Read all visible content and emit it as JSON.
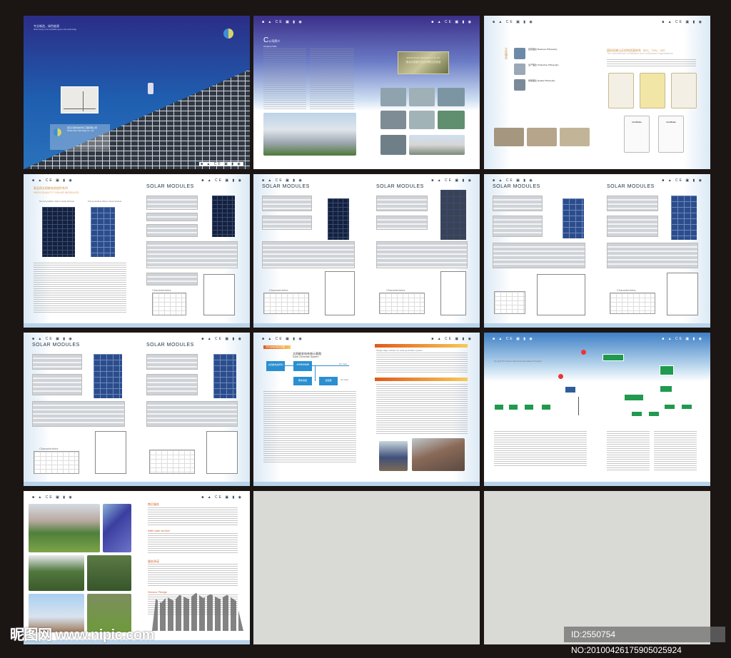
{
  "cover": {
    "tagline_cn": "专业制造，绿色能源",
    "tagline_en": "Solar energy is the worldwide green in the world today",
    "company_cn": "武汉日新科技光伏工程有限公司",
    "company_en": "Wuhan Rixin Technology Co., Ltd."
  },
  "certs_icons": "■ ▲ CE ▣ ▮ ◉",
  "intro": {
    "title_cn": "公司简介",
    "title_en": "Company Profile",
    "plaque_en": "WUHAN SOLAR TECHNOLOGY CO.,LTD.",
    "plaque_cn": "湖北太阳能光伏技术联合实验室"
  },
  "culture": {
    "side_title": "文化理念",
    "items": [
      "经营理念 Business Philosophy",
      "生产理念 Production Philosophy",
      "质量理念 Quality Philosophy"
    ],
    "cert_title_cn": "国际权威认证机构质量体系（IEC、TUV、CE）",
    "cert_title_en": "The International Certificates from Authorized Organizations",
    "cert_labels": [
      "Certificate",
      "Certificate"
    ]
  },
  "spec": {
    "series_cn": "高品质太阳能电池组件系列",
    "series_en": "HIGH QUALITY SOLAR MODULES",
    "title": "SOLAR MODULES",
    "chart_title": "Characteristics",
    "mono_label": "Monocrystalline Silicon Solar Module",
    "poly_label": "Polycrystalline Silicon Solar Module"
  },
  "system": {
    "header_cn": "光伏发电系统示意图",
    "title_cn": "太阳能发电系统示意图",
    "title_en": "Solar Generate System",
    "boxes": [
      "太阳能电池阵列",
      "太阳能控制器",
      "蓄电池组",
      "逆变器"
    ],
    "loads": [
      "DC load",
      "AC load"
    ],
    "right_heading": "Single-stage solution for solar generation system"
  },
  "grid": {
    "title_en": "On-grid PV System Structural Operating Principles"
  },
  "service": {
    "title_cn": "售后服务",
    "subtitle_en": "After-sale service",
    "sub2_cn": "服务承诺",
    "sub3_en": "Service Pledge"
  },
  "watermark": {
    "site_cn": "昵图网",
    "site_url": "www.nipic.com",
    "id": "ID:2550754 NO:20100426175905025924"
  }
}
